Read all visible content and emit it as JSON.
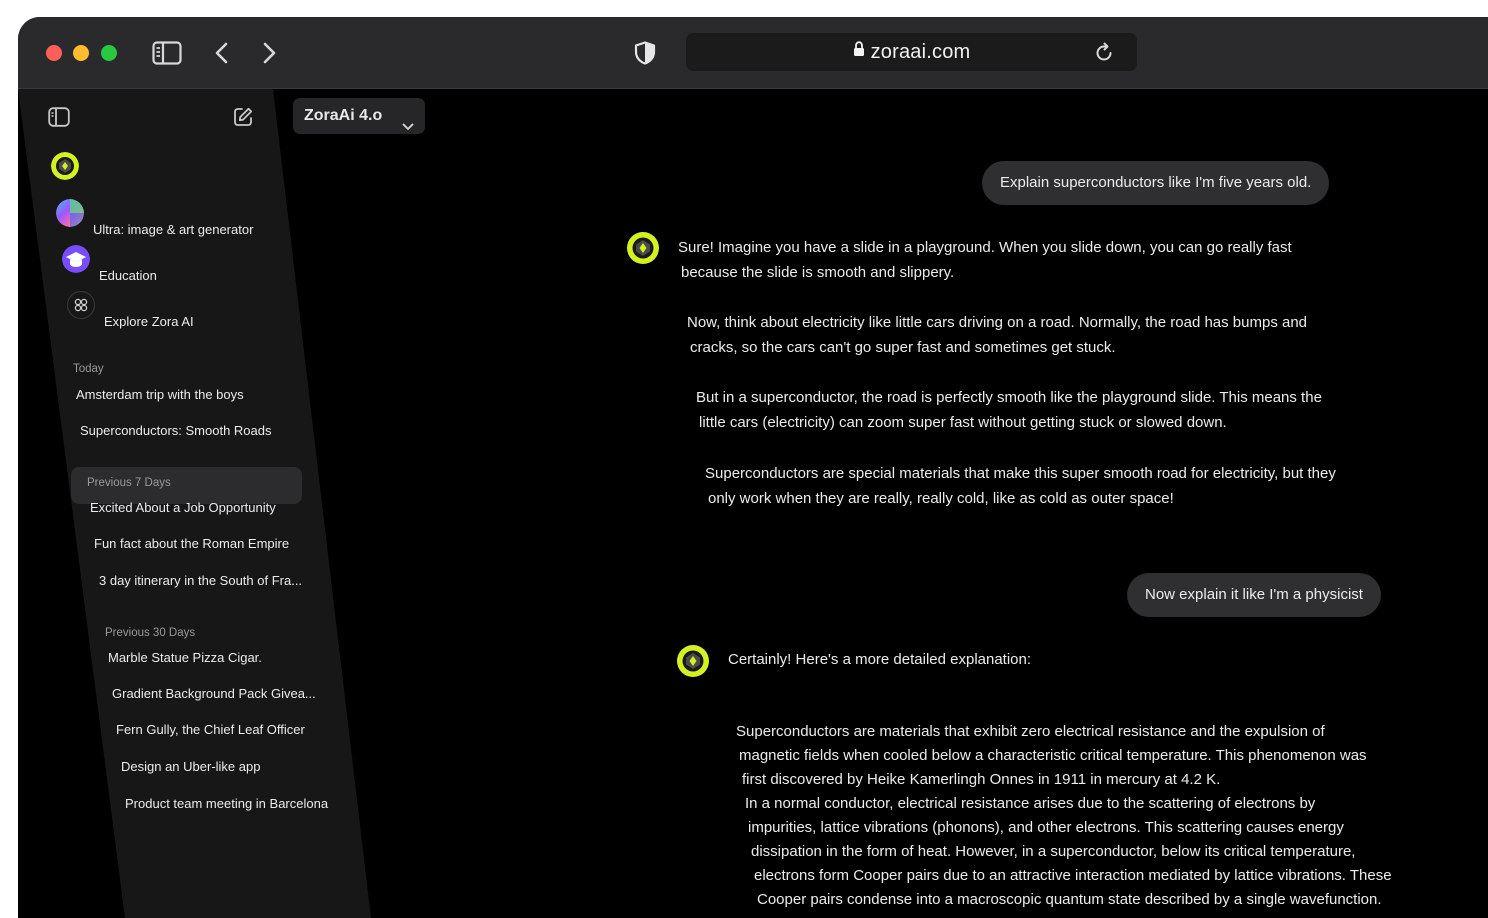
{
  "browser": {
    "url": "zoraai.com"
  },
  "sidebar": {
    "pinned": [
      {
        "label": "Ultra: image & art generator"
      },
      {
        "label": "Education"
      },
      {
        "label": "Explore Zora AI"
      }
    ],
    "sections": [
      {
        "heading": "Today",
        "items": [
          "Amsterdam trip with the boys",
          "Superconductors: Smooth Roads"
        ]
      },
      {
        "heading": "Previous 7 Days",
        "items": [
          "Excited About a Job Opportunity",
          "Fun fact about the Roman Empire",
          "3 day itinerary in the South of Fra..."
        ]
      },
      {
        "heading": "Previous 30 Days",
        "items": [
          "Marble Statue Pizza Cigar.",
          "Gradient Background Pack Givea...",
          "Fern Gully, the Chief Leaf Officer",
          "Design an Uber-like app",
          "Product team meeting in Barcelona"
        ]
      }
    ]
  },
  "model": {
    "selected": "ZoraAi 4.o"
  },
  "conversation": {
    "user_1": "Explain superconductors like I'm five years old.",
    "assistant_1": [
      "Sure! Imagine you have a slide in a playground. When you slide down, you can go really fast",
      "because the slide is smooth and slippery.",
      "Now, think about electricity like little cars driving on a road. Normally, the road has bumps and",
      "cracks, so the cars can't go super fast and sometimes get stuck.",
      "But in a superconductor, the road is perfectly smooth like the playground slide. This means the",
      "little cars (electricity) can zoom super fast without getting stuck or slowed down.",
      "Superconductors are special materials that make this super smooth road for electricity, but they",
      "only work when they are really, really cold, like as cold as outer space!"
    ],
    "user_2": "Now explain it like I'm a physicist",
    "assistant_2_intro": "Certainly! Here's a more detailed explanation:",
    "assistant_2": [
      "Superconductors are materials that exhibit zero electrical resistance and the expulsion of",
      "magnetic fields when cooled below a characteristic critical temperature. This phenomenon was",
      "first discovered by Heike Kamerlingh Onnes in 1911 in mercury at 4.2 K.",
      "In a normal conductor, electrical resistance arises due to the scattering of electrons by",
      "impurities, lattice vibrations (phonons), and other electrons. This scattering causes energy",
      "dissipation in the form of heat. However, in a superconductor, below its critical temperature,",
      "electrons form Cooper pairs due to an attractive interaction mediated by lattice vibrations. These",
      "Cooper pairs condense into a macroscopic quantum state described by a single wavefunction."
    ]
  },
  "colors": {
    "accent": "#d4f21d",
    "bubble": "#2f2f31",
    "sidebar": "#171717"
  },
  "icons": [
    "sidebar-toggle-icon",
    "back-icon",
    "forward-icon",
    "shield-icon",
    "lock-icon",
    "reload-icon",
    "new-chat-icon",
    "zora-logo-icon",
    "education-icon",
    "explore-grid-icon",
    "chevron-down-icon"
  ]
}
